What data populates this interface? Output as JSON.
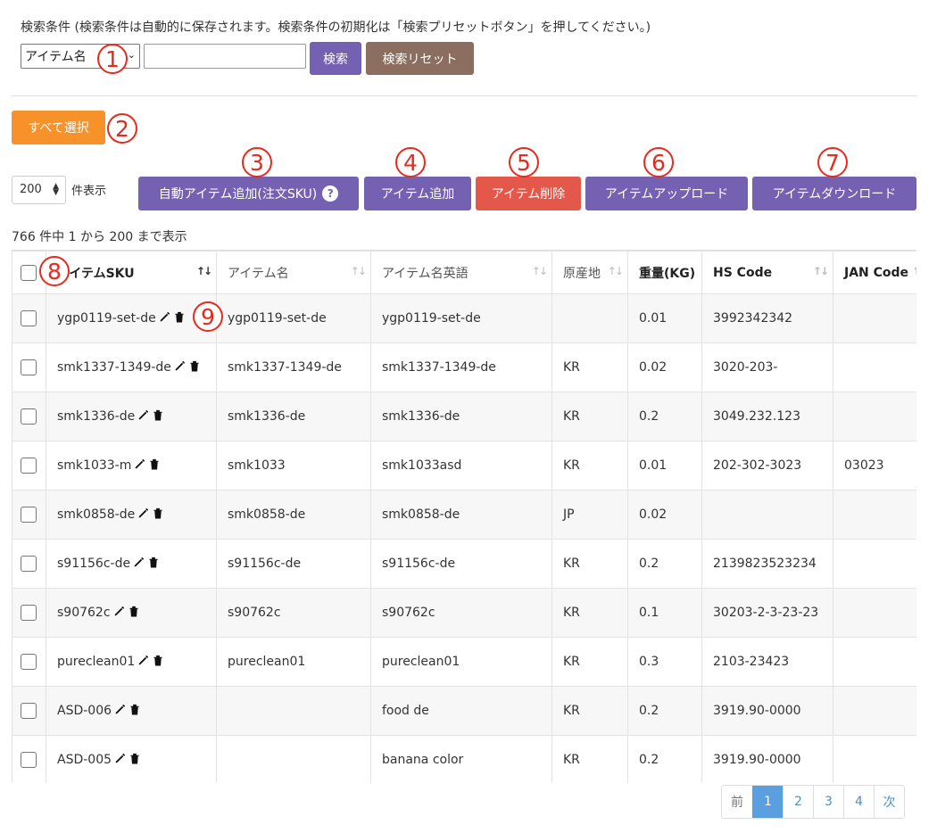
{
  "search": {
    "notice": "検索条件 (検索条件は自動的に保存されます。検索条件の初期化は「検索プリセットボタン」を押してください。)",
    "field_selected": "アイテム名",
    "input_value": "",
    "search_label": "検索",
    "reset_label": "検索リセット"
  },
  "select_all_label": "すべて選択",
  "length": {
    "value": "200",
    "label": "件表示"
  },
  "toolbar": {
    "auto_add_label": "自動アイテム追加(注文SKU)",
    "auto_add_help": "?",
    "add_label": "アイテム追加",
    "delete_label": "アイテム削除",
    "upload_label": "アイテムアップロード",
    "download_label": "アイテムダウンロード"
  },
  "info": "766 件中 1 から 200 まで表示",
  "table": {
    "columns": [
      "アイテムSKU",
      "アイテム名",
      "アイテム名英語",
      "原産地",
      "重量(KG)",
      "HS Code",
      "JAN Code"
    ],
    "rows": [
      {
        "sku": "ygp0119-set-de",
        "name": "ygp0119-set-de",
        "name_en": "ygp0119-set-de",
        "origin": "",
        "weight": "0.01",
        "hs": "3992342342",
        "jan": ""
      },
      {
        "sku": "smk1337-1349-de",
        "name": "smk1337-1349-de",
        "name_en": "smk1337-1349-de",
        "origin": "KR",
        "weight": "0.02",
        "hs": "3020-203-",
        "jan": ""
      },
      {
        "sku": "smk1336-de",
        "name": "smk1336-de",
        "name_en": "smk1336-de",
        "origin": "KR",
        "weight": "0.2",
        "hs": "3049.232.123",
        "jan": ""
      },
      {
        "sku": "smk1033-m",
        "name": "smk1033",
        "name_en": "smk1033asd",
        "origin": "KR",
        "weight": "0.01",
        "hs": "202-302-3023",
        "jan": "03023"
      },
      {
        "sku": "smk0858-de",
        "name": "smk0858-de",
        "name_en": "smk0858-de",
        "origin": "JP",
        "weight": "0.02",
        "hs": "",
        "jan": ""
      },
      {
        "sku": "s91156c-de",
        "name": "s91156c-de",
        "name_en": "s91156c-de",
        "origin": "KR",
        "weight": "0.2",
        "hs": "2139823523234",
        "jan": ""
      },
      {
        "sku": "s90762c",
        "name": "s90762c",
        "name_en": "s90762c",
        "origin": "KR",
        "weight": "0.1",
        "hs": "30203-2-3-23-23",
        "jan": ""
      },
      {
        "sku": "pureclean01",
        "name": "pureclean01",
        "name_en": "pureclean01",
        "origin": "KR",
        "weight": "0.3",
        "hs": "2103-23423",
        "jan": ""
      },
      {
        "sku": "ASD-006",
        "name": "",
        "name_en": "food de",
        "origin": "KR",
        "weight": "0.2",
        "hs": "3919.90-0000",
        "jan": ""
      },
      {
        "sku": "ASD-005",
        "name": "",
        "name_en": "banana color",
        "origin": "KR",
        "weight": "0.2",
        "hs": "3919.90-0000",
        "jan": ""
      }
    ]
  },
  "pagination": {
    "prev": "前",
    "pages": [
      "1",
      "2",
      "3",
      "4"
    ],
    "active": "1",
    "next": "次"
  },
  "annotations": [
    "1",
    "2",
    "3",
    "4",
    "5",
    "6",
    "7",
    "8",
    "9"
  ],
  "colors": {
    "purple": "#7461b1",
    "orange": "#f7922b",
    "red": "#e4574b",
    "brown": "#8b6e5f",
    "annotation": "#e62a1e"
  }
}
